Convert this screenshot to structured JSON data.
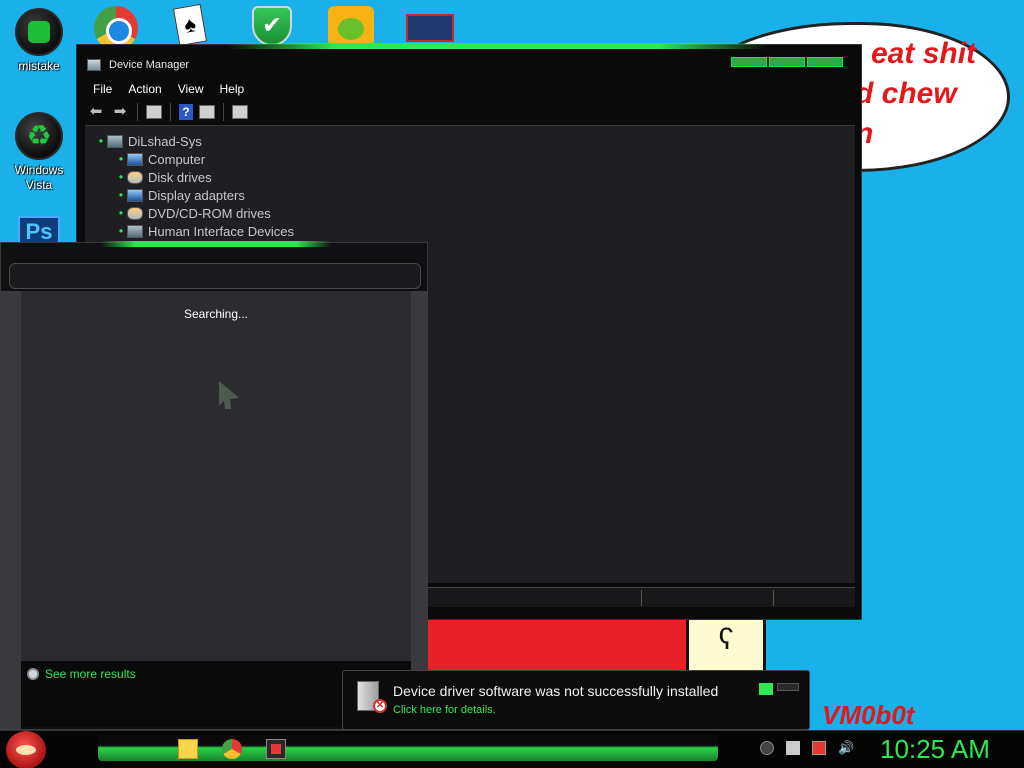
{
  "desktop": {
    "icons": [
      {
        "label": "mistake"
      },
      {
        "label": "Windows Vista"
      }
    ],
    "bubble_lines": [
      "eat shit",
      "d chew",
      "n"
    ],
    "watermark": "VM0b0t"
  },
  "device_manager": {
    "title": "Device Manager",
    "menu": [
      "File",
      "Action",
      "View",
      "Help"
    ],
    "tree": {
      "root": "DiLshad-Sys",
      "items": [
        "Computer",
        "Disk drives",
        "Display adapters",
        "DVD/CD-ROM drives",
        "Human Interface Devices"
      ]
    }
  },
  "search_panel": {
    "status": "Searching...",
    "see_more": "See more results"
  },
  "notification": {
    "message": "Device driver software was not successfully installed",
    "link": "Click here for details."
  },
  "taskbar": {
    "clock": "10:25 AM"
  },
  "colors": {
    "accent": "#2ee84f",
    "desktop": "#1ab0ea",
    "window": "#0a0a0a"
  }
}
